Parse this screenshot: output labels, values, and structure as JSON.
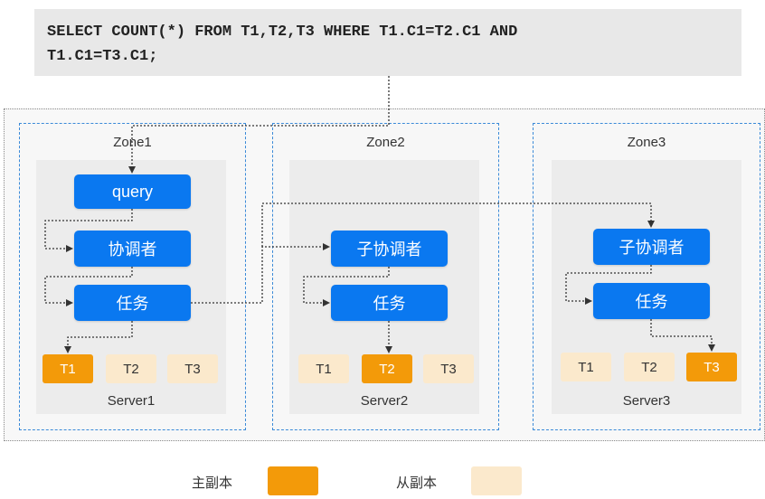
{
  "sql_text": "SELECT COUNT(*) FROM T1,T2,T3 WHERE T1.C1=T2.C1 AND\nT1.C1=T3.C1;",
  "zones": [
    {
      "title": "Zone1",
      "server": "Server1",
      "nodes": [
        "query",
        "协调者",
        "任务"
      ],
      "replicas": [
        "T1",
        "T2",
        "T3"
      ],
      "leader": "T1"
    },
    {
      "title": "Zone2",
      "server": "Server2",
      "nodes": [
        "子协调者",
        "任务"
      ],
      "replicas": [
        "T1",
        "T2",
        "T3"
      ],
      "leader": "T2"
    },
    {
      "title": "Zone3",
      "server": "Server3",
      "nodes": [
        "子协调者",
        "任务"
      ],
      "replicas": [
        "T1",
        "T2",
        "T3"
      ],
      "leader": "T3"
    }
  ],
  "legend": {
    "leader_label": "主副本",
    "follower_label": "从副本"
  },
  "colors": {
    "node": "#0a78f0",
    "leader": "#f39a09",
    "follower": "#fbe9cc",
    "zone_border": "#3b8ad8"
  }
}
